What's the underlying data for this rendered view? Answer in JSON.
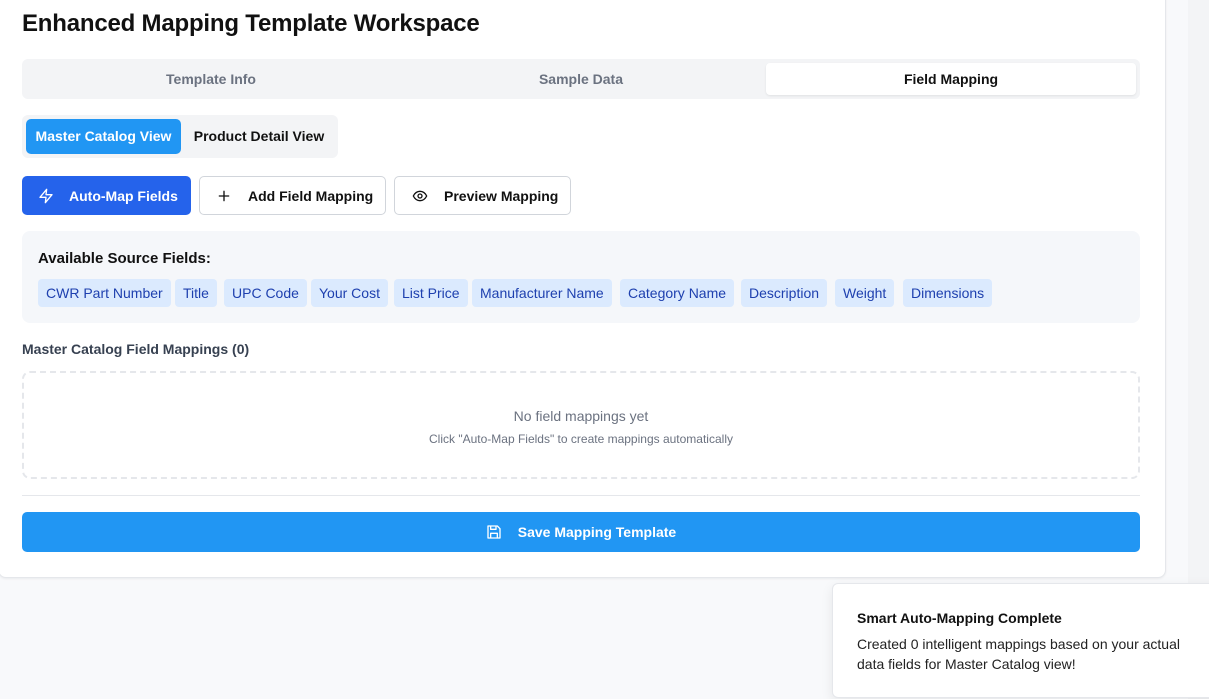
{
  "page": {
    "title": "Enhanced Mapping Template Workspace"
  },
  "tabs": [
    {
      "label": "Template Info",
      "active": false
    },
    {
      "label": "Sample Data",
      "active": false
    },
    {
      "label": "Field Mapping",
      "active": true
    }
  ],
  "views": [
    {
      "label": "Master Catalog View",
      "active": true
    },
    {
      "label": "Product Detail View",
      "active": false
    }
  ],
  "actions": {
    "auto_map": {
      "label": "Auto-Map Fields",
      "icon": "lightning-icon"
    },
    "add_mapping": {
      "label": "Add Field Mapping",
      "icon": "plus-icon"
    },
    "preview": {
      "label": "Preview Mapping",
      "icon": "eye-icon"
    }
  },
  "source_fields": {
    "title": "Available Source Fields:",
    "fields": [
      "CWR Part Number",
      "Title",
      "UPC Code",
      "Your Cost",
      "List Price",
      "Manufacturer Name",
      "Category Name",
      "Description",
      "Weight",
      "Dimensions"
    ]
  },
  "mappings": {
    "title": "Master Catalog Field Mappings (0)",
    "empty_title": "No field mappings yet",
    "empty_hint": "Click \"Auto-Map Fields\" to create mappings automatically"
  },
  "save": {
    "label": "Save Mapping Template",
    "icon": "save-icon"
  },
  "toast": {
    "title": "Smart Auto-Mapping Complete",
    "message": "Created 0 intelligent mappings based on your actual data fields for Master Catalog view!"
  },
  "colors": {
    "primary": "#2563eb",
    "accent": "#2196f3",
    "chip_bg": "#dbeafe",
    "chip_text": "#1e40af"
  }
}
